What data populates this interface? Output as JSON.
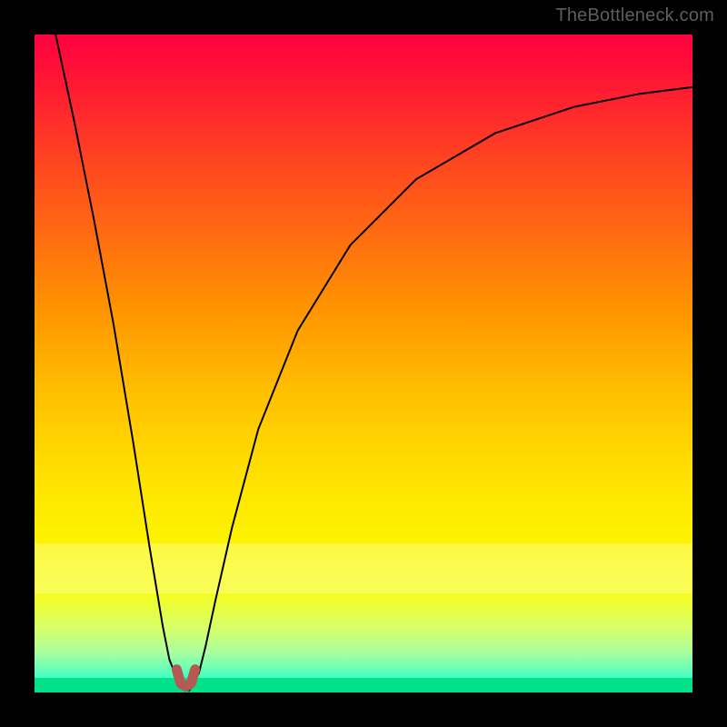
{
  "watermark": "TheBottleneck.com",
  "chart_data": {
    "type": "line",
    "title": "",
    "xlabel": "",
    "ylabel": "",
    "xlim": [
      0,
      1
    ],
    "ylim": [
      0,
      1
    ],
    "series": [
      {
        "name": "bottleneck-curve",
        "x": [
          0.032,
          0.06,
          0.09,
          0.12,
          0.15,
          0.175,
          0.195,
          0.205,
          0.215,
          0.225,
          0.23,
          0.235,
          0.24,
          0.25,
          0.26,
          0.275,
          0.3,
          0.34,
          0.4,
          0.48,
          0.58,
          0.7,
          0.82,
          0.92,
          1.0
        ],
        "y": [
          1.0,
          0.87,
          0.72,
          0.56,
          0.38,
          0.22,
          0.1,
          0.05,
          0.025,
          0.01,
          0.005,
          0.003,
          0.01,
          0.03,
          0.07,
          0.14,
          0.25,
          0.4,
          0.55,
          0.68,
          0.78,
          0.85,
          0.89,
          0.91,
          0.92
        ]
      },
      {
        "name": "min-marker",
        "x": [
          0.216,
          0.222,
          0.23,
          0.238,
          0.244
        ],
        "y": [
          0.035,
          0.014,
          0.009,
          0.014,
          0.035
        ]
      }
    ],
    "annotations": [],
    "colors": {
      "curve": "#000000",
      "marker": "#b35a52",
      "gradient_top": "#ff0040",
      "gradient_bottom": "#00ff99"
    }
  }
}
